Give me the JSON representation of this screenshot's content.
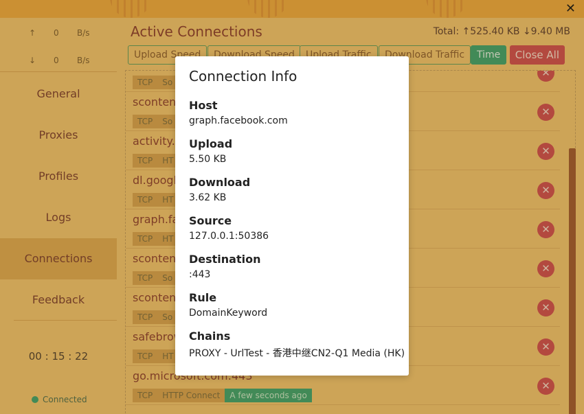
{
  "window": {
    "close_glyph": "✕"
  },
  "sidebar": {
    "upload": {
      "arrow": "↑",
      "value": "0",
      "unit": "B/s"
    },
    "download": {
      "arrow": "↓",
      "value": "0",
      "unit": "B/s"
    },
    "nav": [
      {
        "label": "General"
      },
      {
        "label": "Proxies"
      },
      {
        "label": "Profiles"
      },
      {
        "label": "Logs"
      },
      {
        "label": "Connections"
      },
      {
        "label": "Feedback"
      }
    ],
    "clock": "00 : 15 : 22",
    "status": "Connected"
  },
  "main": {
    "title": "Active Connections",
    "totals": "Total: ↑525.40 KB ↓9.40 MB",
    "sort_buttons": [
      "Upload Speed",
      "Download Speed",
      "Upload Traffic",
      "Download Traffic",
      "Time"
    ],
    "close_all": "Close All",
    "connections": [
      {
        "host": "",
        "tags": [
          "TCP",
          "So"
        ]
      },
      {
        "host": "scontent",
        "tags": [
          "TCP",
          "So"
        ]
      },
      {
        "host": "activity.w",
        "tags": [
          "TCP",
          "HT"
        ]
      },
      {
        "host": "dl.google",
        "tags": [
          "TCP",
          "HT"
        ]
      },
      {
        "host": "graph.fa",
        "tags": [
          "TCP",
          "HT"
        ]
      },
      {
        "host": "scontent",
        "tags": [
          "TCP",
          "So"
        ]
      },
      {
        "host": "scontent",
        "tags": [
          "TCP",
          "So"
        ]
      },
      {
        "host": "safebrow",
        "tags": [
          "TCP",
          "HT"
        ]
      },
      {
        "host": "go.microsoft.com:443",
        "tags": [
          "TCP",
          "HTTP Connect"
        ],
        "time": "A few seconds ago"
      }
    ],
    "row_close_glyph": "✕"
  },
  "modal": {
    "title": "Connection Info",
    "fields": [
      {
        "label": "Host",
        "value": "graph.facebook.com"
      },
      {
        "label": "Upload",
        "value": "5.50 KB"
      },
      {
        "label": "Download",
        "value": "3.62 KB"
      },
      {
        "label": "Source",
        "value": "127.0.0.1:50386"
      },
      {
        "label": "Destination",
        "value": ":443"
      },
      {
        "label": "Rule",
        "value": "DomainKeyword"
      },
      {
        "label": "Chains",
        "value": "PROXY - UrlTest - 香港中继CN2-Q1 Media (HK)"
      }
    ]
  },
  "colors": {
    "accent": "#f3c36a",
    "danger": "#d04a4a",
    "success": "#3aa06a"
  }
}
